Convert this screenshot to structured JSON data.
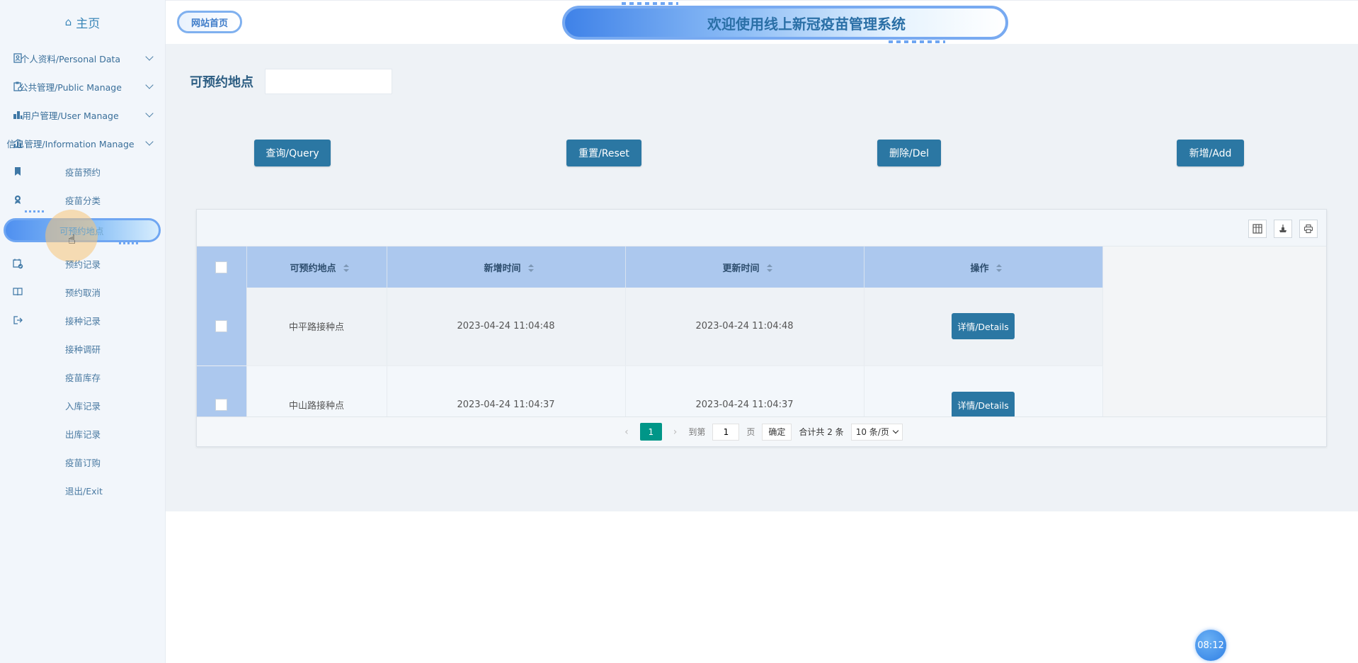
{
  "sidebar": {
    "home": "主页",
    "groups": [
      {
        "label": "个人资料/Personal Data",
        "icon": "person-doc-icon"
      },
      {
        "label": "公共管理/Public Manage",
        "icon": "clipboard-icon"
      },
      {
        "label": "用户管理/User Manage",
        "icon": "building-icon"
      },
      {
        "label": "信息管理/Information Manage",
        "icon": "chart-icon"
      }
    ],
    "items": [
      {
        "label": "疫苗预约",
        "icon": "bookmark-icon"
      },
      {
        "label": "疫苗分类",
        "icon": "award-icon"
      },
      {
        "label": "可预约地点",
        "icon": "",
        "active": true
      },
      {
        "label": "预约记录",
        "icon": "calendar-check-icon"
      },
      {
        "label": "预约取消",
        "icon": "book-icon"
      },
      {
        "label": "接种记录",
        "icon": "logout-icon"
      },
      {
        "label": "接种调研",
        "icon": ""
      },
      {
        "label": "疫苗库存",
        "icon": ""
      },
      {
        "label": "入库记录",
        "icon": ""
      },
      {
        "label": "出库记录",
        "icon": ""
      },
      {
        "label": "疫苗订购",
        "icon": ""
      },
      {
        "label": "退出/Exit",
        "icon": ""
      }
    ]
  },
  "header": {
    "site_home": "网站首页",
    "banner_title": "欢迎使用线上新冠疫苗管理系统"
  },
  "search": {
    "label": "可预约地点",
    "value": "",
    "placeholder": ""
  },
  "actions": {
    "query": "查询/Query",
    "reset": "重置/Reset",
    "del": "删除/Del",
    "add": "新增/Add"
  },
  "table": {
    "columns": [
      "可预约地点",
      "新增时间",
      "更新时间",
      "操作"
    ],
    "rows": [
      {
        "place": "中平路接种点",
        "created": "2023-04-24 11:04:48",
        "updated": "2023-04-24 11:04:48",
        "action": "详情/Details"
      },
      {
        "place": "中山路接种点",
        "created": "2023-04-24 11:04:37",
        "updated": "2023-04-24 11:04:37",
        "action": "详情/Details"
      }
    ]
  },
  "pager": {
    "current": "1",
    "goto_label": "到第",
    "goto_value": "1",
    "page_unit": "页",
    "confirm": "确定",
    "total": "合计共 2 条",
    "page_size": "10 条/页"
  },
  "clock": "08:12",
  "colors": {
    "primary_button": "#2b77a3",
    "header_row": "#acc8ee",
    "active_page": "#009688"
  }
}
